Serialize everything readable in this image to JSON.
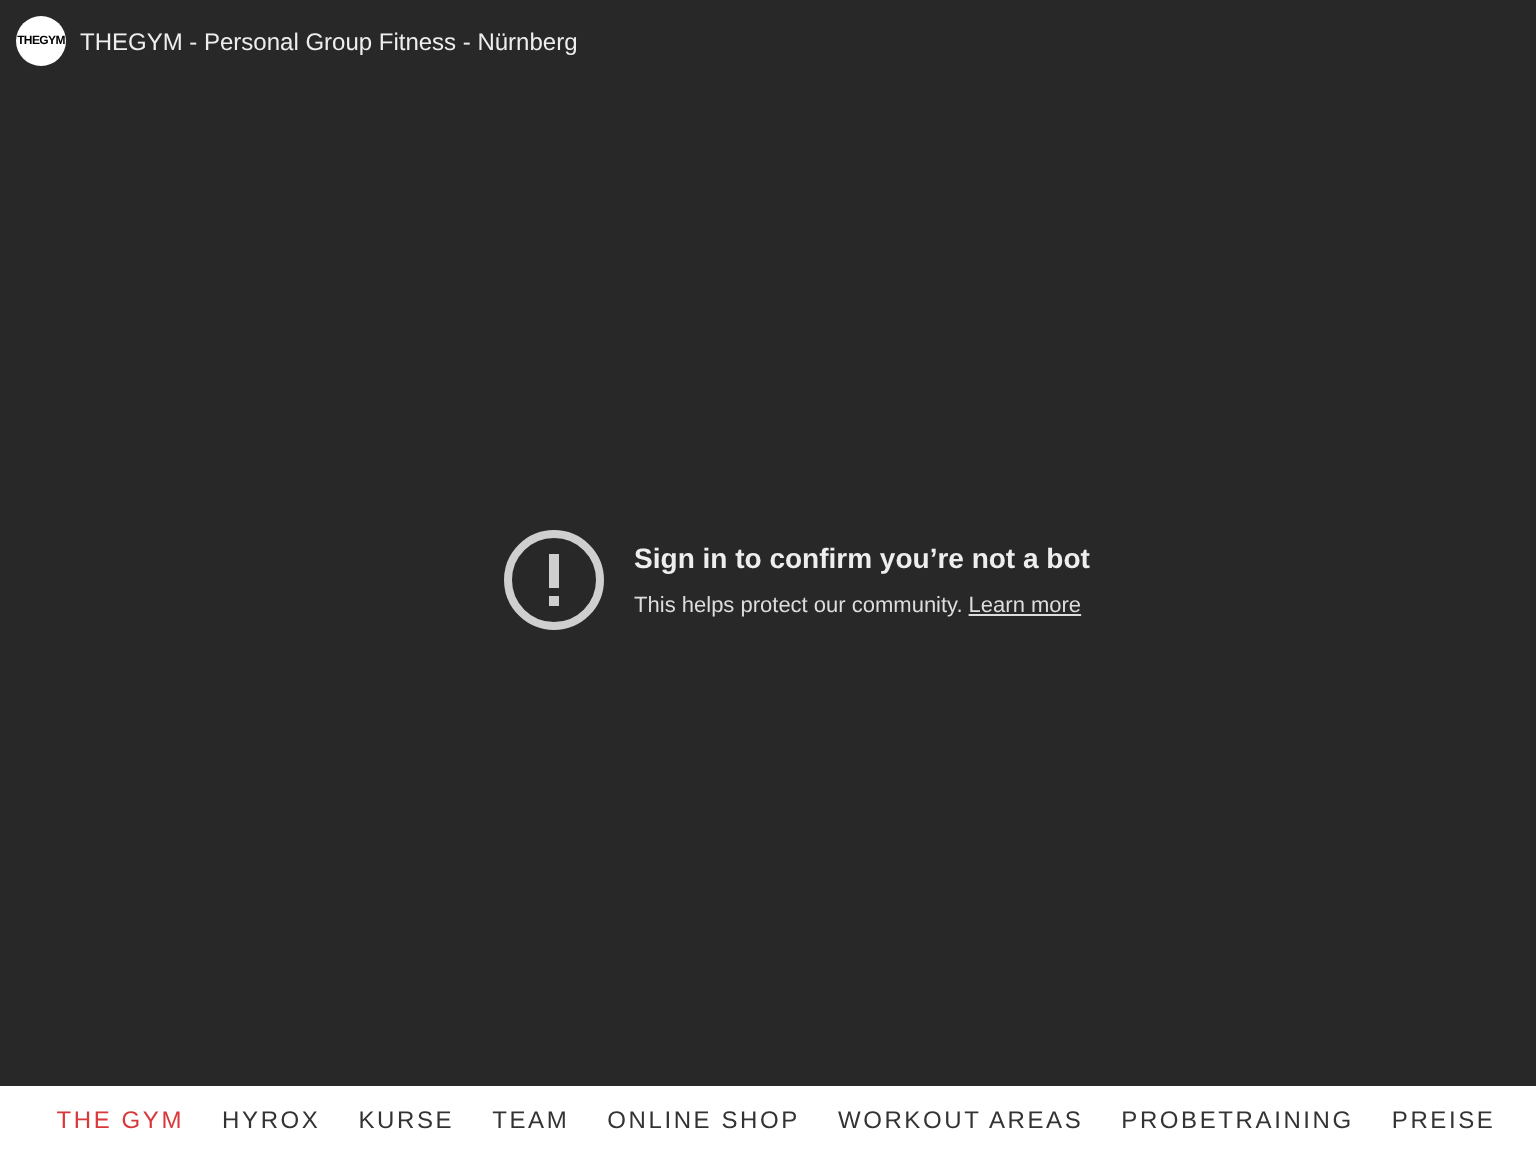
{
  "video": {
    "channel_logo": "THEGYM",
    "title": "THEGYM - Personal Group Fitness - Nürnberg",
    "error": {
      "heading": "Sign in to confirm you’re not a bot",
      "message": "This helps protect our community.",
      "link": "Learn more"
    }
  },
  "nav": [
    {
      "label": "THE GYM",
      "selected": true
    },
    {
      "label": "HYROX",
      "selected": false
    },
    {
      "label": "KURSE",
      "selected": false
    },
    {
      "label": "TEAM",
      "selected": false
    },
    {
      "label": "ONLINE SHOP",
      "selected": false
    },
    {
      "label": "WORKOUT AREAS",
      "selected": false
    },
    {
      "label": "PROBETRAINING",
      "selected": false
    },
    {
      "label": "PREISE",
      "selected": false
    }
  ]
}
